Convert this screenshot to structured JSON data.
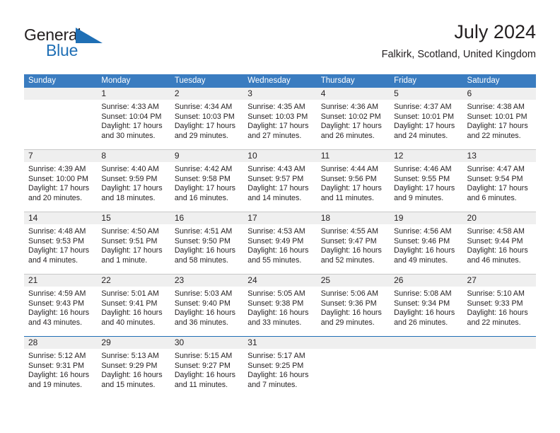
{
  "brand": {
    "name_part1": "General",
    "name_part2": "Blue",
    "triangle_icon": "blue-triangle-icon",
    "accent_color": "#1f6fb5"
  },
  "header": {
    "title": "July 2024",
    "subtitle": "Falkirk, Scotland, United Kingdom"
  },
  "calendar": {
    "header_bg": "#3a7cc0",
    "number_band_bg": "#efefef",
    "weekdays": [
      "Sunday",
      "Monday",
      "Tuesday",
      "Wednesday",
      "Thursday",
      "Friday",
      "Saturday"
    ],
    "weeks": [
      [
        {
          "day": "",
          "lines": []
        },
        {
          "day": "1",
          "lines": [
            "Sunrise: 4:33 AM",
            "Sunset: 10:04 PM",
            "Daylight: 17 hours",
            "and 30 minutes."
          ]
        },
        {
          "day": "2",
          "lines": [
            "Sunrise: 4:34 AM",
            "Sunset: 10:03 PM",
            "Daylight: 17 hours",
            "and 29 minutes."
          ]
        },
        {
          "day": "3",
          "lines": [
            "Sunrise: 4:35 AM",
            "Sunset: 10:03 PM",
            "Daylight: 17 hours",
            "and 27 minutes."
          ]
        },
        {
          "day": "4",
          "lines": [
            "Sunrise: 4:36 AM",
            "Sunset: 10:02 PM",
            "Daylight: 17 hours",
            "and 26 minutes."
          ]
        },
        {
          "day": "5",
          "lines": [
            "Sunrise: 4:37 AM",
            "Sunset: 10:01 PM",
            "Daylight: 17 hours",
            "and 24 minutes."
          ]
        },
        {
          "day": "6",
          "lines": [
            "Sunrise: 4:38 AM",
            "Sunset: 10:01 PM",
            "Daylight: 17 hours",
            "and 22 minutes."
          ]
        }
      ],
      [
        {
          "day": "7",
          "lines": [
            "Sunrise: 4:39 AM",
            "Sunset: 10:00 PM",
            "Daylight: 17 hours",
            "and 20 minutes."
          ]
        },
        {
          "day": "8",
          "lines": [
            "Sunrise: 4:40 AM",
            "Sunset: 9:59 PM",
            "Daylight: 17 hours",
            "and 18 minutes."
          ]
        },
        {
          "day": "9",
          "lines": [
            "Sunrise: 4:42 AM",
            "Sunset: 9:58 PM",
            "Daylight: 17 hours",
            "and 16 minutes."
          ]
        },
        {
          "day": "10",
          "lines": [
            "Sunrise: 4:43 AM",
            "Sunset: 9:57 PM",
            "Daylight: 17 hours",
            "and 14 minutes."
          ]
        },
        {
          "day": "11",
          "lines": [
            "Sunrise: 4:44 AM",
            "Sunset: 9:56 PM",
            "Daylight: 17 hours",
            "and 11 minutes."
          ]
        },
        {
          "day": "12",
          "lines": [
            "Sunrise: 4:46 AM",
            "Sunset: 9:55 PM",
            "Daylight: 17 hours",
            "and 9 minutes."
          ]
        },
        {
          "day": "13",
          "lines": [
            "Sunrise: 4:47 AM",
            "Sunset: 9:54 PM",
            "Daylight: 17 hours",
            "and 6 minutes."
          ]
        }
      ],
      [
        {
          "day": "14",
          "lines": [
            "Sunrise: 4:48 AM",
            "Sunset: 9:53 PM",
            "Daylight: 17 hours",
            "and 4 minutes."
          ]
        },
        {
          "day": "15",
          "lines": [
            "Sunrise: 4:50 AM",
            "Sunset: 9:51 PM",
            "Daylight: 17 hours",
            "and 1 minute."
          ]
        },
        {
          "day": "16",
          "lines": [
            "Sunrise: 4:51 AM",
            "Sunset: 9:50 PM",
            "Daylight: 16 hours",
            "and 58 minutes."
          ]
        },
        {
          "day": "17",
          "lines": [
            "Sunrise: 4:53 AM",
            "Sunset: 9:49 PM",
            "Daylight: 16 hours",
            "and 55 minutes."
          ]
        },
        {
          "day": "18",
          "lines": [
            "Sunrise: 4:55 AM",
            "Sunset: 9:47 PM",
            "Daylight: 16 hours",
            "and 52 minutes."
          ]
        },
        {
          "day": "19",
          "lines": [
            "Sunrise: 4:56 AM",
            "Sunset: 9:46 PM",
            "Daylight: 16 hours",
            "and 49 minutes."
          ]
        },
        {
          "day": "20",
          "lines": [
            "Sunrise: 4:58 AM",
            "Sunset: 9:44 PM",
            "Daylight: 16 hours",
            "and 46 minutes."
          ]
        }
      ],
      [
        {
          "day": "21",
          "lines": [
            "Sunrise: 4:59 AM",
            "Sunset: 9:43 PM",
            "Daylight: 16 hours",
            "and 43 minutes."
          ]
        },
        {
          "day": "22",
          "lines": [
            "Sunrise: 5:01 AM",
            "Sunset: 9:41 PM",
            "Daylight: 16 hours",
            "and 40 minutes."
          ]
        },
        {
          "day": "23",
          "lines": [
            "Sunrise: 5:03 AM",
            "Sunset: 9:40 PM",
            "Daylight: 16 hours",
            "and 36 minutes."
          ]
        },
        {
          "day": "24",
          "lines": [
            "Sunrise: 5:05 AM",
            "Sunset: 9:38 PM",
            "Daylight: 16 hours",
            "and 33 minutes."
          ]
        },
        {
          "day": "25",
          "lines": [
            "Sunrise: 5:06 AM",
            "Sunset: 9:36 PM",
            "Daylight: 16 hours",
            "and 29 minutes."
          ]
        },
        {
          "day": "26",
          "lines": [
            "Sunrise: 5:08 AM",
            "Sunset: 9:34 PM",
            "Daylight: 16 hours",
            "and 26 minutes."
          ]
        },
        {
          "day": "27",
          "lines": [
            "Sunrise: 5:10 AM",
            "Sunset: 9:33 PM",
            "Daylight: 16 hours",
            "and 22 minutes."
          ]
        }
      ],
      [
        {
          "day": "28",
          "lines": [
            "Sunrise: 5:12 AM",
            "Sunset: 9:31 PM",
            "Daylight: 16 hours",
            "and 19 minutes."
          ]
        },
        {
          "day": "29",
          "lines": [
            "Sunrise: 5:13 AM",
            "Sunset: 9:29 PM",
            "Daylight: 16 hours",
            "and 15 minutes."
          ]
        },
        {
          "day": "30",
          "lines": [
            "Sunrise: 5:15 AM",
            "Sunset: 9:27 PM",
            "Daylight: 16 hours",
            "and 11 minutes."
          ]
        },
        {
          "day": "31",
          "lines": [
            "Sunrise: 5:17 AM",
            "Sunset: 9:25 PM",
            "Daylight: 16 hours",
            "and 7 minutes."
          ]
        },
        {
          "day": "",
          "lines": []
        },
        {
          "day": "",
          "lines": []
        },
        {
          "day": "",
          "lines": []
        }
      ]
    ]
  }
}
